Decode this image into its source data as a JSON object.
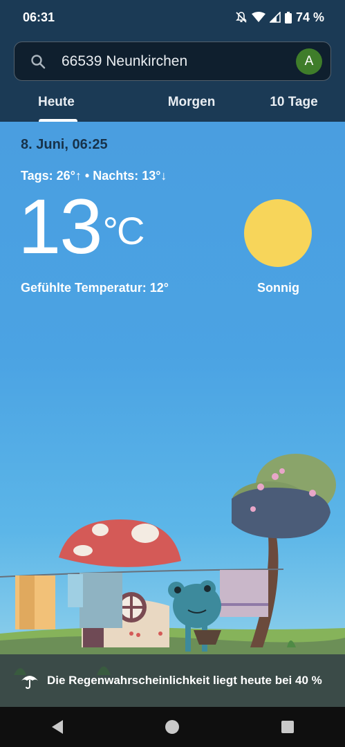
{
  "status": {
    "time": "06:31",
    "battery": "74 %",
    "icons": [
      "do-not-disturb-icon",
      "wifi-icon",
      "signal-icon",
      "battery-icon"
    ]
  },
  "search": {
    "value": "66539 Neunkirchen",
    "avatar_letter": "A"
  },
  "tabs": [
    {
      "label": "Heute",
      "active": true
    },
    {
      "label": "Morgen",
      "active": false
    },
    {
      "label": "10 Tage",
      "active": false
    }
  ],
  "weather": {
    "date": "8. Juni, 06:25",
    "hilo": "Tags: 26°↑ • Nachts: 13°↓",
    "temperature": "13",
    "unit": "°C",
    "feels_like": "Gefühlte Temperatur: 12°",
    "condition": "Sonnig"
  },
  "rain": {
    "text": "Die Regenwahrscheinlichkeit liegt heute bei 40 %"
  },
  "colors": {
    "sky": "#4a9ee0",
    "sun": "#f7d55a",
    "header": "#1b3a55"
  }
}
